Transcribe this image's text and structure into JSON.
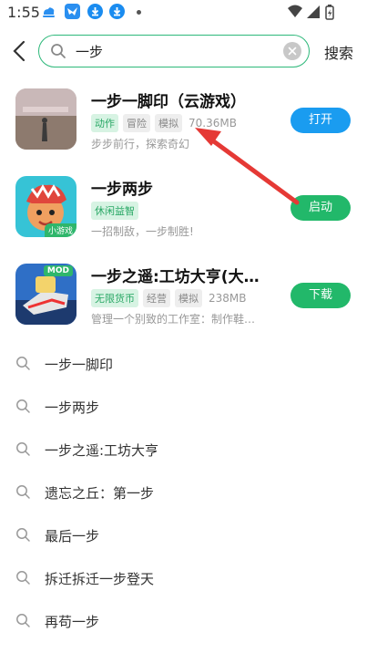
{
  "status_bar": {
    "time": "1:55"
  },
  "search": {
    "query": "一步",
    "submit_label": "搜索"
  },
  "apps": [
    {
      "title": "一步一脚印（云游戏）",
      "tags": [
        {
          "text": "动作",
          "green": true
        },
        {
          "text": "冒险",
          "green": false
        },
        {
          "text": "模拟",
          "green": false
        }
      ],
      "size": "70.36MB",
      "description": "步步前行，探索奇幻",
      "action": "打开",
      "action_color": "#1a9cf0"
    },
    {
      "title": "一步两步",
      "tags": [
        {
          "text": "休闲益智",
          "green": true
        }
      ],
      "size": "",
      "description": "一招制敌，一步制胜!",
      "action": "启动",
      "action_color": "#22b86a",
      "badge": "小游戏"
    },
    {
      "title": "一步之遥:工坊大亨(大量…",
      "tags": [
        {
          "text": "无限货币",
          "green": true
        },
        {
          "text": "经营",
          "green": false
        },
        {
          "text": "模拟",
          "green": false
        }
      ],
      "size": "238MB",
      "description": "管理一个别致的工作室：制作鞋…",
      "action": "下载",
      "action_color": "#22b86a",
      "badge": "MOD"
    }
  ],
  "suggestions": [
    "一步一脚印",
    "一步两步",
    "一步之遥:工坊大亨",
    "遗忘之丘：第一步",
    "最后一步",
    "拆迁拆迁一步登天",
    "再苟一步"
  ],
  "colors": {
    "accent_green": "#22b86a",
    "accent_blue": "#1a9cf0",
    "annotation_red": "#e53935"
  }
}
